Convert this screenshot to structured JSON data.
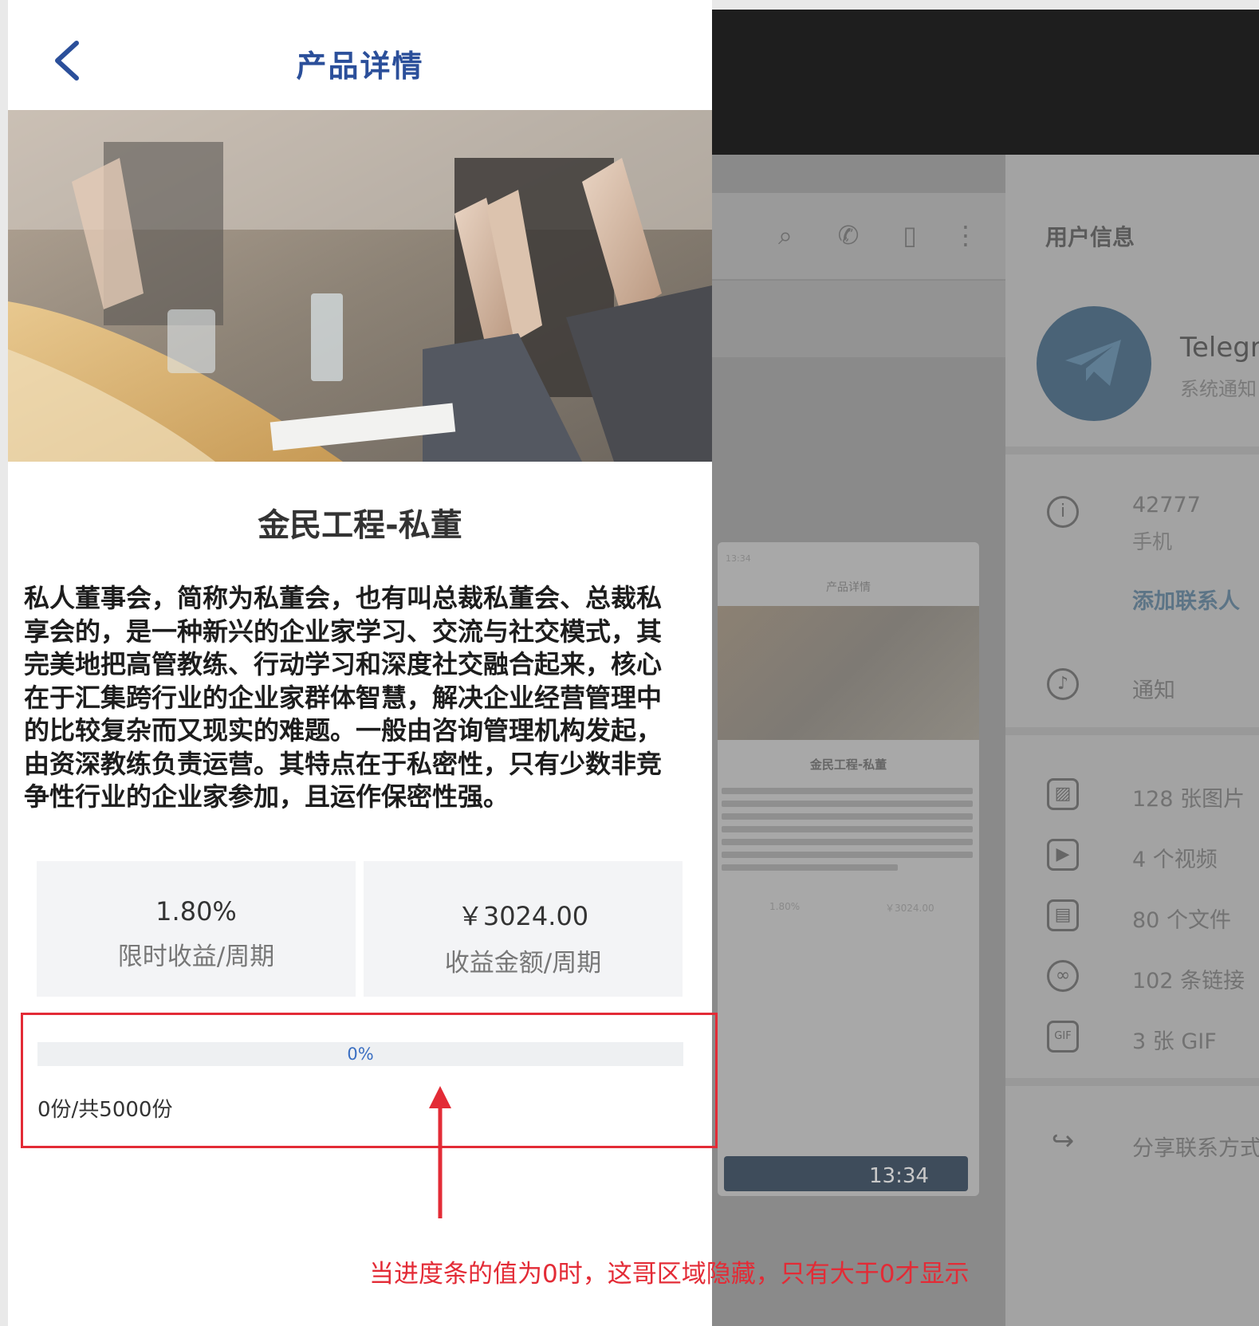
{
  "phone": {
    "nav_title": "产品详情",
    "product_title": "金民工程-私董",
    "description": "私人董事会，简称为私董会，也有叫总裁私董会、总裁私享会的，是一种新兴的企业家学习、交流与社交模式，其完美地把高管教练、行动学习和深度社交融合起来，核心在于汇集跨行业的企业家群体智慧，解决企业经营管理中的比较复杂而又现实的难题。一般由咨询管理机构发起，由资深教练负责运营。其特点在于私密性，只有少数非竞争性行业的企业家参加，且运作保密性强。",
    "stats": [
      {
        "value": "1.80%",
        "label": "限时收益/周期"
      },
      {
        "value": "￥3024.00",
        "label": "收益金额/周期"
      }
    ],
    "progress": {
      "percent_value": 0,
      "percent_label": "0%",
      "shares_label": "0份/共5000份"
    }
  },
  "annotation": {
    "note": "当进度条的值为0时，这哥区域隐藏，只有大于0才显示",
    "color": "#e32b36"
  },
  "telegram": {
    "side_title": "用户信息",
    "contact_name": "Telegra",
    "contact_sub": "系统通知",
    "phone_number": "42777",
    "phone_label": "手机",
    "add_contact": "添加联系人",
    "notifications": "通知",
    "media": [
      {
        "icon": "image-icon",
        "label": "128 张图片"
      },
      {
        "icon": "video-icon",
        "label": "4 个视频"
      },
      {
        "icon": "file-icon",
        "label": "80 个文件"
      },
      {
        "icon": "link-icon",
        "label": "102 条链接"
      },
      {
        "icon": "gif-icon",
        "label": "3 张 GIF"
      }
    ],
    "share_contact": "分享联系方式",
    "message_time": "13:34",
    "mini_title": "产品详情",
    "mini_product": "金民工程-私董",
    "mini_status": "13:34",
    "mini_stat_left": "1.80%",
    "mini_stat_right": "￥3024.00"
  },
  "colors": {
    "nav_title": "#2b4f9a",
    "progress": "#3b6fc2",
    "annotation": "#e32b36"
  }
}
